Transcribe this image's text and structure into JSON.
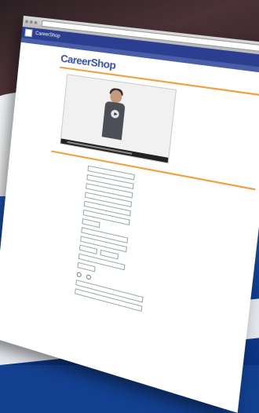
{
  "site": {
    "name": "CareerShop",
    "logo_text": "CareerShop"
  },
  "colors": {
    "site_header": "#2c3e8f",
    "accent_rule": "#f0a040",
    "background_blue": "#123f8f"
  }
}
